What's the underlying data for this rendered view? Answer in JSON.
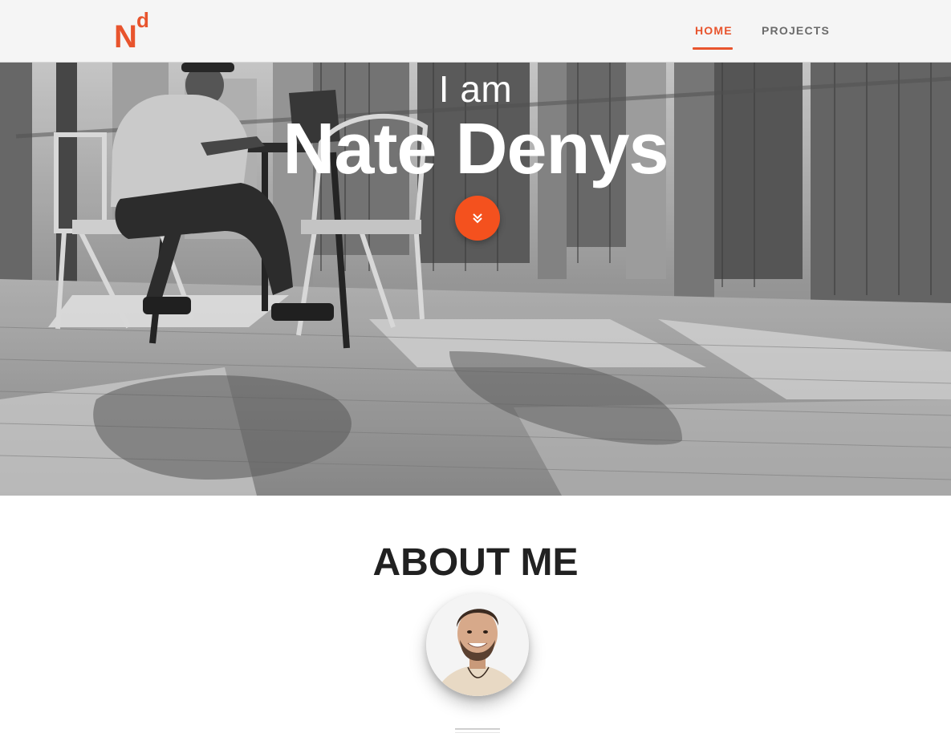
{
  "navbar": {
    "logo": {
      "letter_main": "N",
      "letter_super": "d"
    },
    "links": [
      {
        "label": "HOME",
        "active": true
      },
      {
        "label": "PROJECTS",
        "active": false
      }
    ]
  },
  "hero": {
    "intro": "I am",
    "name": "Nate Denys",
    "scroll_icon": "double-chevron-down-icon"
  },
  "about": {
    "title": "ABOUT ME"
  },
  "colors": {
    "accent": "#e8542d",
    "scroll_button": "#f4511e",
    "heading": "#212121",
    "navbar_bg": "#f5f5f5"
  }
}
